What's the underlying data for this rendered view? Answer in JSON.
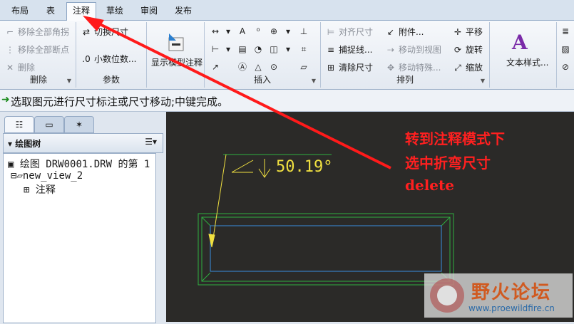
{
  "tabs": [
    "布局",
    "表",
    "注释",
    "草绘",
    "审阅",
    "发布"
  ],
  "ribbon": {
    "delete_group": {
      "label": "删除",
      "items": [
        "移除全部角拐",
        "移除全部断点",
        "删除"
      ]
    },
    "params_group": {
      "label": "参数",
      "items": [
        "切换尺寸",
        "小数位数..."
      ]
    },
    "show_group": {
      "items": [
        "显示模型注释"
      ]
    },
    "insert_group": {
      "label": "插入"
    },
    "arrange_group": {
      "label": "排列",
      "items": [
        "对齐尺寸",
        "捕捉线...",
        "清除尺寸",
        "附件...",
        "移动到视图",
        "移动特殊..."
      ]
    },
    "move_group": {
      "items": [
        "平移",
        "旋转",
        "缩放"
      ]
    },
    "format_group": {
      "items": [
        "文本样式..."
      ]
    }
  },
  "status": {
    "message": "选取图元进行尺寸标注或尺寸移动;中键完成。"
  },
  "tree": {
    "title": "绘图树",
    "items": [
      "绘图 DRW0001.DRW 的第 1",
      "new_view_2",
      "注释"
    ]
  },
  "canvas": {
    "dimension_text": "50.19°",
    "annotation_lines": [
      "转到注释模式下",
      "选中折弯尺寸",
      "delete"
    ]
  },
  "watermark": {
    "name": "野火论坛",
    "url": "www.proewildfire.cn"
  },
  "colors": {
    "canvas_bg": "#2b2a28",
    "dimension": "#f0e040",
    "geometry_blue": "#3a8fe0",
    "geometry_green": "#2fb040",
    "annotation_red": "#ff2020"
  }
}
